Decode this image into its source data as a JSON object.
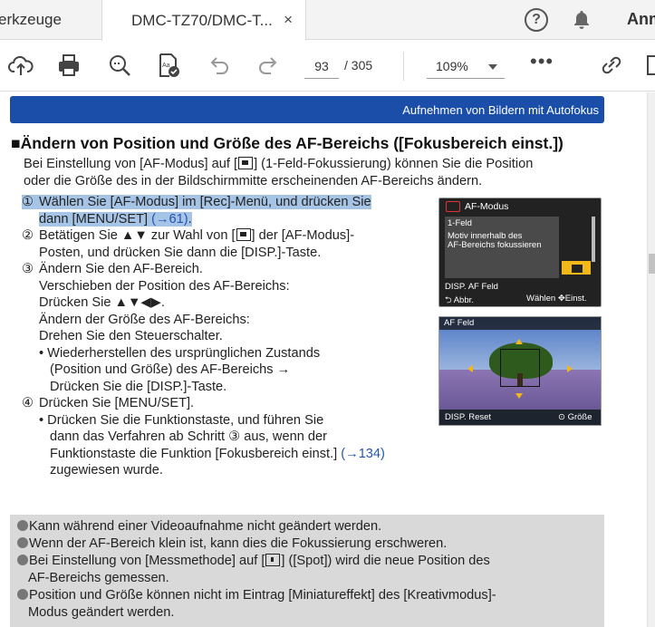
{
  "tabs": [
    {
      "label": "erkzeuge"
    },
    {
      "label": "DMC-TZ70/DMC-T..."
    }
  ],
  "tab_close": "×",
  "account_label": "Anm",
  "toolbar": {
    "page_current": "93",
    "page_total": "/ 305",
    "zoom": "109%",
    "more": "•••"
  },
  "doc": {
    "header_bar": "Aufnehmen von Bildern mit Autofokus",
    "title": "Ändern von Position und Größe des AF-Bereichs ([Fokusbereich einst.])",
    "intro_1a": "Bei Einstellung von [AF-Modus] auf [",
    "intro_1b": "] (1-Feld-Fokussierung) können Sie die Position",
    "intro_2": "oder die Größe des in der Bildschirmmitte erscheinenden AF-Bereichs ändern.",
    "steps": {
      "s1_num": "①",
      "s1_l1": "Wählen Sie [AF-Modus] im [Rec]-Menü, und drücken Sie",
      "s1_l2": "dann [MENU/SET] ",
      "s1_link": "(→61)",
      "s1_end": ".",
      "s2_num": "②",
      "s2_l1a": "Betätigen Sie ▲▼ zur Wahl von [",
      "s2_l1b": "] der [AF-Modus]-",
      "s2_l2": "Posten, und drücken Sie dann die [DISP.]-Taste.",
      "s3_num": "③",
      "s3_l1": "Ändern Sie den AF-Bereich.",
      "s3_l2": "Verschieben der Position des AF-Bereichs:",
      "s3_l3": "Drücken Sie ▲▼◀▶.",
      "s3_l4": "Ändern der Größe des AF-Bereichs:",
      "s3_l5": "Drehen Sie den Steuerschalter.",
      "s3_b1": "• Wiederherstellen des ursprünglichen Zustands",
      "s3_b2": "(Position und Größe) des AF-Bereichs →",
      "s3_b3": "Drücken Sie die [DISP.]-Taste.",
      "s4_num": "④",
      "s4_l1": "Drücken Sie [MENU/SET].",
      "s4_b1": "• Drücken Sie die Funktionstaste, und führen Sie",
      "s4_b2": "dann das Verfahren ab Schritt ③ aus, wenn der",
      "s4_b3": "Funktionstaste die Funktion [Fokusbereich einst.] ",
      "s4_link": "(→134)",
      "s4_b4": "zugewiesen wurde."
    },
    "cam1": {
      "title": "AF-Modus",
      "item1": "1-Feld",
      "item2": "Motiv innerhalb des",
      "item3": "AF-Bereichs fokussieren",
      "af": "DISP. AF Feld",
      "abbr": "⮌ Abbr.",
      "wahl": "Wählen ✥Einst."
    },
    "cam2": {
      "label": "AF Feld",
      "reset": "DISP. Reset",
      "grosse": "⊙ Größe"
    },
    "notes": {
      "n1": "Kann während einer Videoaufnahme nicht geändert werden.",
      "n2": "Wenn der AF-Bereich klein ist, kann dies die Fokussierung erschweren.",
      "n3a": "Bei Einstellung von [Messmethode] auf [",
      "n3b": "] ([Spot]) wird die neue Position des",
      "n3c": "AF-Bereichs gemessen.",
      "n4a": "Position und Größe können nicht im Eintrag [Miniatureffekt] des [Kreativmodus]-",
      "n4b": "Modus geändert werden."
    }
  },
  "colors": {
    "header_bar": "#1a4ea8",
    "highlight": "#a6c5e6",
    "link": "#2454b0",
    "notes_bg": "#d9d9d9"
  },
  "icons": [
    "help-icon",
    "bell-icon",
    "upload-cloud-icon",
    "print-icon",
    "zoom-search-icon",
    "fill-sign-icon",
    "undo-icon",
    "redo-icon",
    "share-link-icon",
    "close-icon"
  ]
}
